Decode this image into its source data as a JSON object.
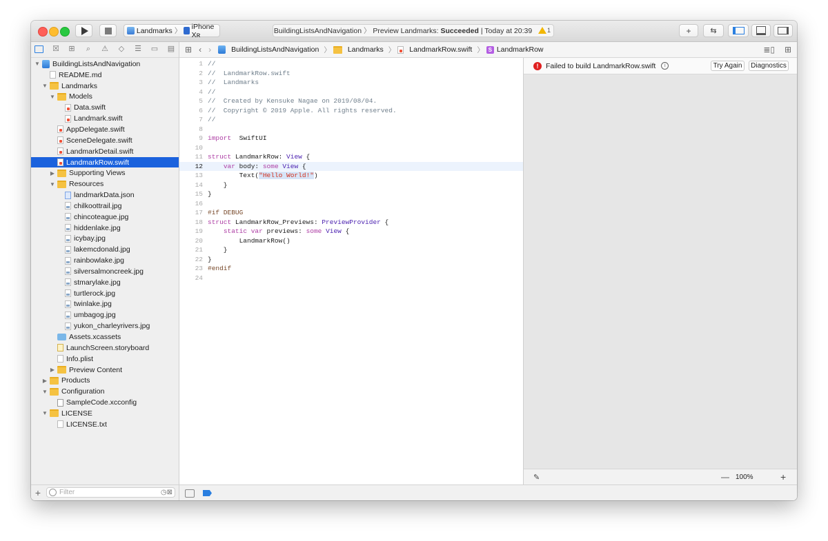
{
  "toolbar": {
    "scheme_target": "Landmarks",
    "scheme_device": "iPhone Xʀ",
    "activity_project": "BuildingListsAndNavigation",
    "activity_action": "Preview Landmarks:",
    "activity_status": "Succeeded",
    "activity_time": "Today at 20:39",
    "warning_count": "1"
  },
  "navigator": {
    "filter_placeholder": "Filter",
    "items": [
      {
        "label": "BuildingListsAndNavigation",
        "level": 0,
        "icon": "project-icon",
        "disclosure": "open"
      },
      {
        "label": "README.md",
        "level": 1,
        "icon": "doc-icon"
      },
      {
        "label": "Landmarks",
        "level": 1,
        "icon": "folder-icon",
        "disclosure": "open"
      },
      {
        "label": "Models",
        "level": 2,
        "icon": "folder-icon",
        "disclosure": "open"
      },
      {
        "label": "Data.swift",
        "level": 3,
        "icon": "swift-file-icon"
      },
      {
        "label": "Landmark.swift",
        "level": 3,
        "icon": "swift-file-icon"
      },
      {
        "label": "AppDelegate.swift",
        "level": 2,
        "icon": "swift-file-icon"
      },
      {
        "label": "SceneDelegate.swift",
        "level": 2,
        "icon": "swift-file-icon"
      },
      {
        "label": "LandmarkDetail.swift",
        "level": 2,
        "icon": "swift-file-icon"
      },
      {
        "label": "LandmarkRow.swift",
        "level": 2,
        "icon": "swift-file-icon",
        "selected": true
      },
      {
        "label": "Supporting Views",
        "level": 2,
        "icon": "folder-icon",
        "disclosure": "closed"
      },
      {
        "label": "Resources",
        "level": 2,
        "icon": "folder-icon",
        "disclosure": "open"
      },
      {
        "label": "landmarkData.json",
        "level": 3,
        "icon": "json-file-icon"
      },
      {
        "label": "chilkoottrail.jpg",
        "level": 3,
        "icon": "image-file-icon"
      },
      {
        "label": "chincoteague.jpg",
        "level": 3,
        "icon": "image-file-icon"
      },
      {
        "label": "hiddenlake.jpg",
        "level": 3,
        "icon": "image-file-icon"
      },
      {
        "label": "icybay.jpg",
        "level": 3,
        "icon": "image-file-icon"
      },
      {
        "label": "lakemcdonald.jpg",
        "level": 3,
        "icon": "image-file-icon"
      },
      {
        "label": "rainbowlake.jpg",
        "level": 3,
        "icon": "image-file-icon"
      },
      {
        "label": "silversalmoncreek.jpg",
        "level": 3,
        "icon": "image-file-icon"
      },
      {
        "label": "stmarylake.jpg",
        "level": 3,
        "icon": "image-file-icon"
      },
      {
        "label": "turtlerock.jpg",
        "level": 3,
        "icon": "image-file-icon"
      },
      {
        "label": "twinlake.jpg",
        "level": 3,
        "icon": "image-file-icon"
      },
      {
        "label": "umbagog.jpg",
        "level": 3,
        "icon": "image-file-icon"
      },
      {
        "label": "yukon_charleyrivers.jpg",
        "level": 3,
        "icon": "image-file-icon"
      },
      {
        "label": "Assets.xcassets",
        "level": 2,
        "icon": "assets-icon"
      },
      {
        "label": "LaunchScreen.storyboard",
        "level": 2,
        "icon": "storyboard-icon"
      },
      {
        "label": "Info.plist",
        "level": 2,
        "icon": "doc-icon"
      },
      {
        "label": "Preview Content",
        "level": 2,
        "icon": "folder-icon",
        "disclosure": "closed"
      },
      {
        "label": "Products",
        "level": 1,
        "icon": "folder-icon",
        "disclosure": "closed"
      },
      {
        "label": "Configuration",
        "level": 1,
        "icon": "folder-icon",
        "disclosure": "open"
      },
      {
        "label": "SampleCode.xcconfig",
        "level": 2,
        "icon": "config-file-icon"
      },
      {
        "label": "LICENSE",
        "level": 1,
        "icon": "folder-icon",
        "disclosure": "open"
      },
      {
        "label": "LICENSE.txt",
        "level": 2,
        "icon": "doc-icon"
      }
    ]
  },
  "jumpbar": {
    "crumbs": [
      "BuildingListsAndNavigation",
      "Landmarks",
      "LandmarkRow.swift",
      "LandmarkRow"
    ]
  },
  "editor": {
    "current_line": 12,
    "lines": [
      [
        [
          "cm",
          "//"
        ]
      ],
      [
        [
          "cm",
          "//  LandmarkRow.swift"
        ]
      ],
      [
        [
          "cm",
          "//  Landmarks"
        ]
      ],
      [
        [
          "cm",
          "//"
        ]
      ],
      [
        [
          "cm",
          "//  Created by Kensuke Nagae on 2019/08/04."
        ]
      ],
      [
        [
          "cm",
          "//  Copyright © 2019 Apple. All rights reserved."
        ]
      ],
      [
        [
          "cm",
          "//"
        ]
      ],
      [],
      [
        [
          "kw",
          "import"
        ],
        [
          "",
          "  SwiftUI"
        ]
      ],
      [],
      [
        [
          "kw",
          "struct"
        ],
        [
          "",
          " LandmarkRow: "
        ],
        [
          "ty",
          "View"
        ],
        [
          "",
          " {"
        ]
      ],
      [
        [
          "",
          "    "
        ],
        [
          "kw",
          "var"
        ],
        [
          "",
          " body: "
        ],
        [
          "kw",
          "some"
        ],
        [
          "",
          " "
        ],
        [
          "ty",
          "View"
        ],
        [
          "",
          " {"
        ]
      ],
      [
        [
          "",
          "        Text("
        ],
        [
          "str",
          "\"Hello World!\""
        ],
        [
          "",
          ")"
        ]
      ],
      [
        [
          "",
          "    }"
        ]
      ],
      [
        [
          "",
          "}"
        ]
      ],
      [],
      [
        [
          "pp",
          "#if DEBUG"
        ]
      ],
      [
        [
          "kw",
          "struct"
        ],
        [
          "",
          " LandmarkRow_Previews: "
        ],
        [
          "ty",
          "PreviewProvider"
        ],
        [
          "",
          " {"
        ]
      ],
      [
        [
          "",
          "    "
        ],
        [
          "kw",
          "static"
        ],
        [
          "",
          " "
        ],
        [
          "kw",
          "var"
        ],
        [
          "",
          " previews: "
        ],
        [
          "kw",
          "some"
        ],
        [
          "",
          " "
        ],
        [
          "ty",
          "View"
        ],
        [
          "",
          " {"
        ]
      ],
      [
        [
          "",
          "        LandmarkRow()"
        ]
      ],
      [
        [
          "",
          "    }"
        ]
      ],
      [
        [
          "",
          "}"
        ]
      ],
      [
        [
          "pp",
          "#endif"
        ]
      ],
      []
    ]
  },
  "canvas": {
    "error_message": "Failed to build LandmarkRow.swift",
    "try_again_label": "Try Again",
    "diagnostics_label": "Diagnostics",
    "zoom_level": "100%"
  },
  "colors": {
    "selection": "#1b62dd",
    "keyword": "#ad3da4",
    "type": "#4b21b0",
    "comment": "#707f8c",
    "error": "#e02020"
  }
}
